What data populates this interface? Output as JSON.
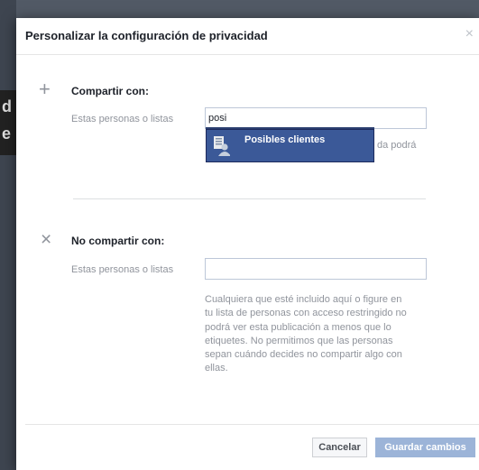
{
  "dialog": {
    "title": "Personalizar la configuración de privacidad",
    "close_icon": "×"
  },
  "share": {
    "icon": "+",
    "title": "Compartir con:",
    "field_label": "Estas personas o listas",
    "input_value": "posi",
    "suggestion": {
      "label": "Posibles clientes",
      "icon": "group-list-icon"
    },
    "partial_hint": "da podrá"
  },
  "noshare": {
    "icon": "×",
    "title": "No compartir con:",
    "field_label": "Estas personas o listas",
    "input_value": "",
    "help_lines": [
      "Cualquiera que esté incluido aquí o figure en",
      "tu lista de personas con acceso restringido no",
      "podrá ver esta publicación a menos que lo",
      "etiquetes. No permitimos que las personas",
      "sepan cuándo decides no compartir algo con",
      "ellas."
    ]
  },
  "footer": {
    "cancel_label": "Cancelar",
    "save_label": "Guardar cambios"
  },
  "background": {
    "fragment_1": "d",
    "fragment_2": "e"
  }
}
